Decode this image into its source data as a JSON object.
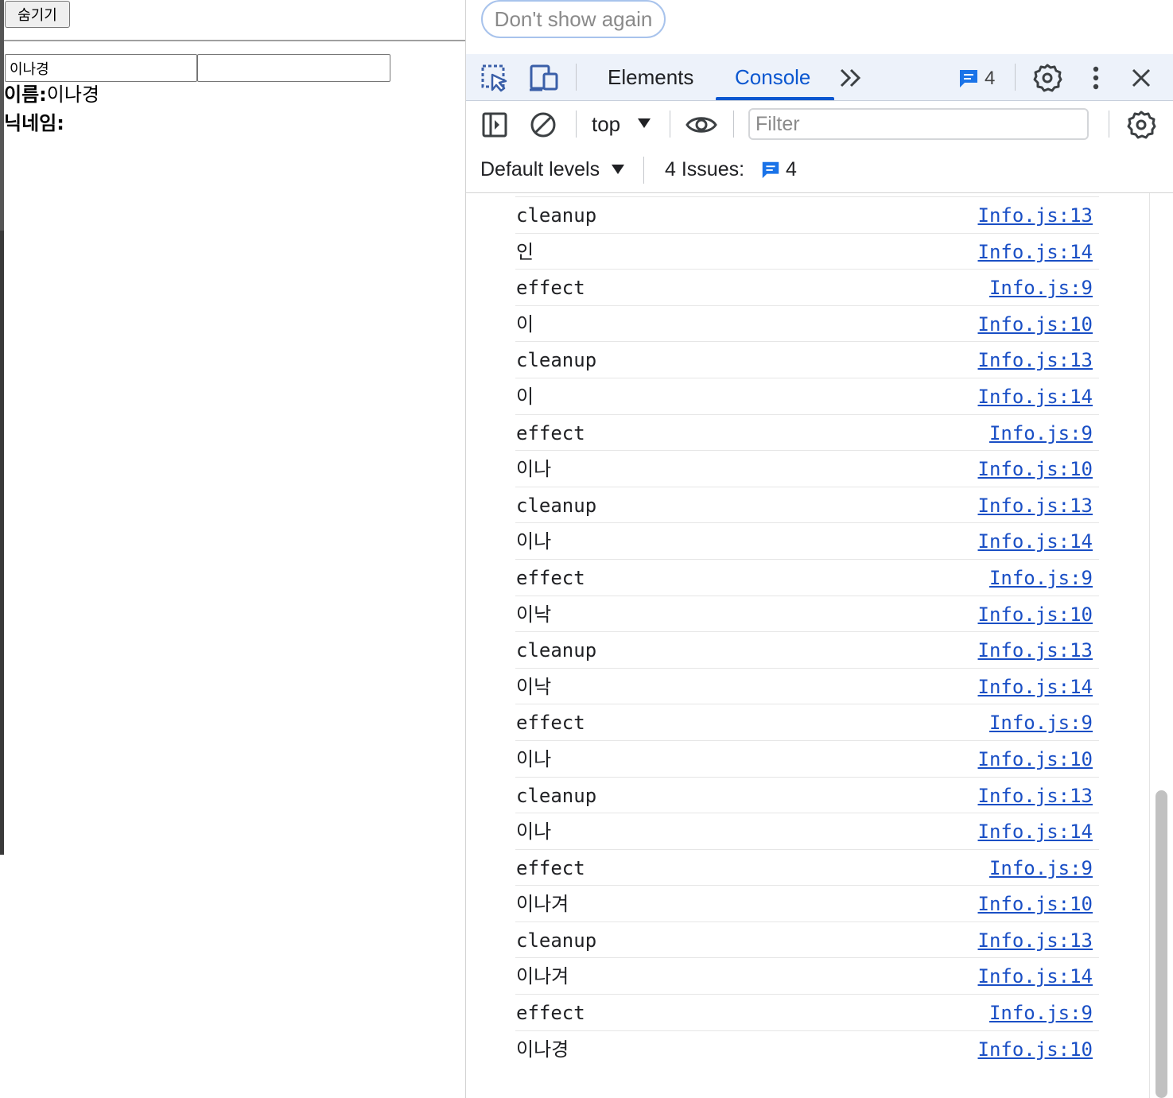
{
  "page": {
    "hide_button": "숨기기",
    "name_input_value": "이나경",
    "nick_input_value": "",
    "name_label": "이름:",
    "name_value": "이나경",
    "nick_label": "닉네임:",
    "nick_value": ""
  },
  "devtools": {
    "dont_show_again": "Don't show again",
    "tabs": {
      "elements": "Elements",
      "console": "Console"
    },
    "issues_badge_count": "4",
    "context": "top",
    "filter_placeholder": "Filter",
    "default_levels": "Default levels",
    "issues_label": "4 Issues:",
    "issues_count": "4",
    "accent_color": "#0b57d0",
    "logs": [
      {
        "msg": "cleanup",
        "src": "Info.js:13"
      },
      {
        "msg": "인",
        "src": "Info.js:14"
      },
      {
        "msg": "effect",
        "src": "Info.js:9"
      },
      {
        "msg": "이",
        "src": "Info.js:10"
      },
      {
        "msg": "cleanup",
        "src": "Info.js:13"
      },
      {
        "msg": "이",
        "src": "Info.js:14"
      },
      {
        "msg": "effect",
        "src": "Info.js:9"
      },
      {
        "msg": "이나",
        "src": "Info.js:10"
      },
      {
        "msg": "cleanup",
        "src": "Info.js:13"
      },
      {
        "msg": "이나",
        "src": "Info.js:14"
      },
      {
        "msg": "effect",
        "src": "Info.js:9"
      },
      {
        "msg": "이낙",
        "src": "Info.js:10"
      },
      {
        "msg": "cleanup",
        "src": "Info.js:13"
      },
      {
        "msg": "이낙",
        "src": "Info.js:14"
      },
      {
        "msg": "effect",
        "src": "Info.js:9"
      },
      {
        "msg": "이나",
        "src": "Info.js:10"
      },
      {
        "msg": "cleanup",
        "src": "Info.js:13"
      },
      {
        "msg": "이나",
        "src": "Info.js:14"
      },
      {
        "msg": "effect",
        "src": "Info.js:9"
      },
      {
        "msg": "이나겨",
        "src": "Info.js:10"
      },
      {
        "msg": "cleanup",
        "src": "Info.js:13"
      },
      {
        "msg": "이나겨",
        "src": "Info.js:14"
      },
      {
        "msg": "effect",
        "src": "Info.js:9"
      },
      {
        "msg": "이나경",
        "src": "Info.js:10"
      }
    ]
  }
}
